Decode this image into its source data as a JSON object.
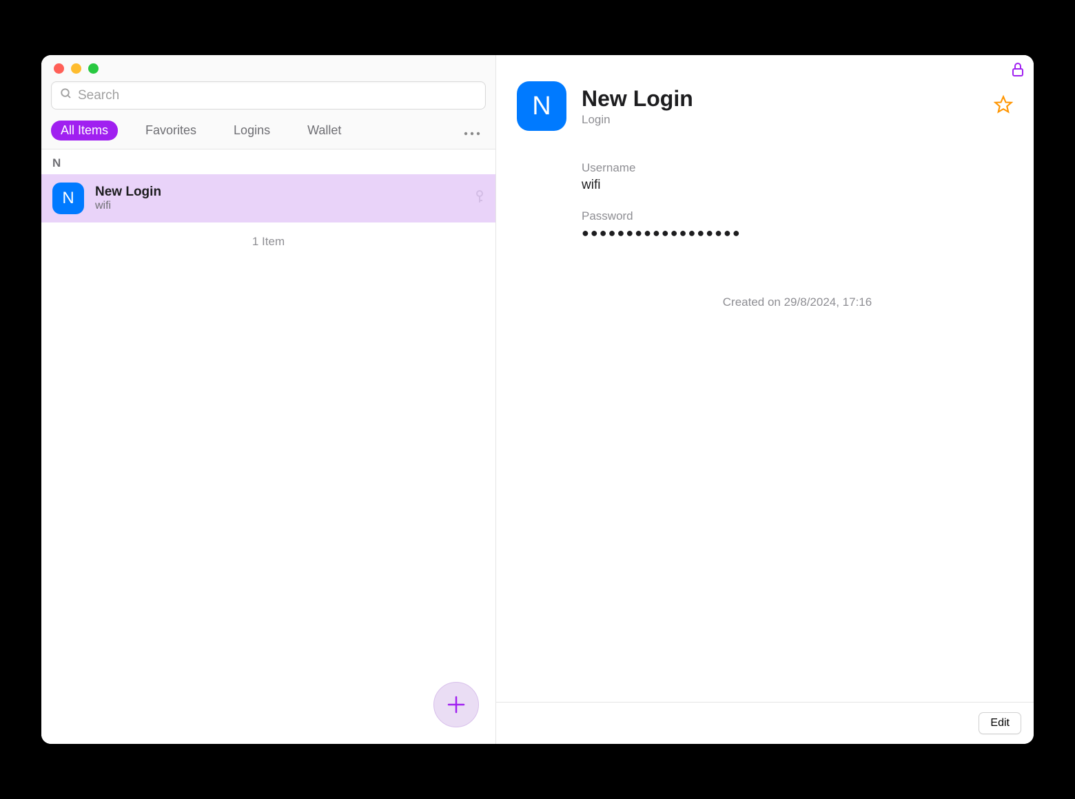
{
  "search": {
    "placeholder": "Search"
  },
  "tabs": {
    "all_items": "All Items",
    "favorites": "Favorites",
    "logins": "Logins",
    "wallet": "Wallet"
  },
  "list": {
    "section_letter": "N",
    "items": [
      {
        "icon_letter": "N",
        "title": "New Login",
        "subtitle": "wifi"
      }
    ],
    "count_text": "1 Item"
  },
  "detail": {
    "icon_letter": "N",
    "title": "New Login",
    "type": "Login",
    "username_label": "Username",
    "username_value": "wifi",
    "password_label": "Password",
    "password_masked": "●●●●●●●●●●●●●●●●●●",
    "created_text": "Created on 29/8/2024, 17:16",
    "edit_label": "Edit"
  }
}
